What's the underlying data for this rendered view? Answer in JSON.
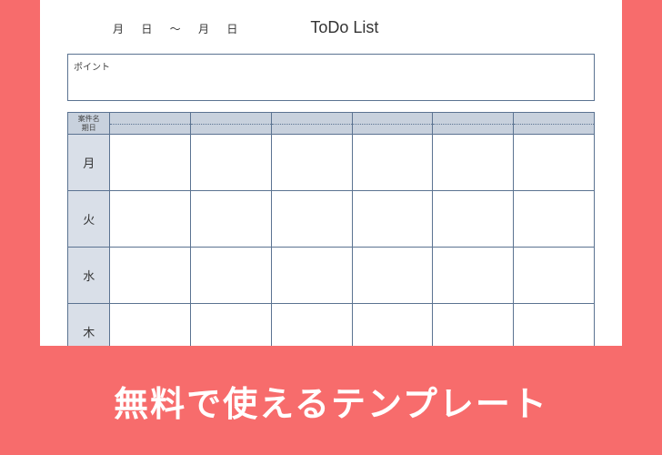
{
  "header": {
    "date_range": "月 日 ～  月 日",
    "title": "ToDo List"
  },
  "point_box": {
    "label": "ポイント"
  },
  "table": {
    "row_header_label_line1": "案件名",
    "row_header_label_line2": "期日",
    "days": [
      "月",
      "火",
      "水",
      "木"
    ],
    "columns": 6
  },
  "banner": {
    "text": "無料で使えるテンプレート"
  }
}
